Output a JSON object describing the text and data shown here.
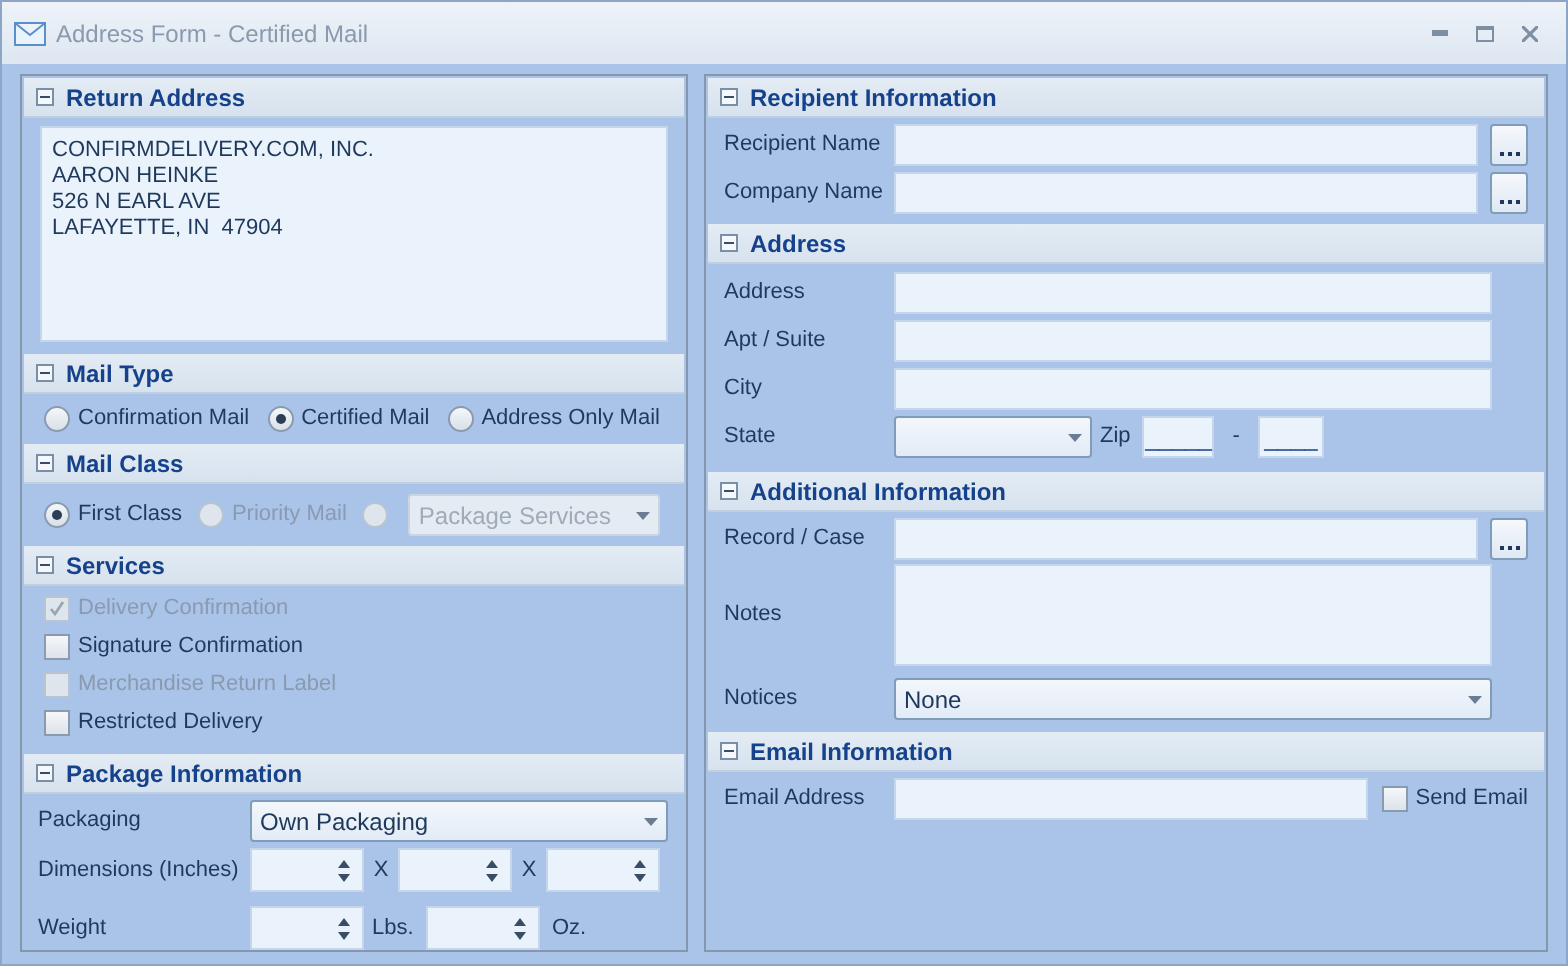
{
  "window": {
    "title": "Address Form - Certified Mail"
  },
  "return_address": {
    "title": "Return Address",
    "lines": [
      "CONFIRMDELIVERY.COM, INC.",
      "AARON HEINKE",
      "526 N EARL AVE",
      "LAFAYETTE, IN  47904"
    ]
  },
  "mail_type": {
    "title": "Mail Type",
    "options": [
      {
        "label": "Confirmation Mail",
        "selected": false
      },
      {
        "label": "Certified Mail",
        "selected": true
      },
      {
        "label": "Address Only Mail",
        "selected": false
      }
    ]
  },
  "mail_class": {
    "title": "Mail Class",
    "options": [
      {
        "kind": "radio",
        "label": "First Class",
        "selected": true,
        "disabled": false
      },
      {
        "kind": "radio",
        "label": "Priority Mail",
        "selected": false,
        "disabled": true
      },
      {
        "kind": "radio_select",
        "value": "Package Services",
        "selected": false,
        "disabled": true
      }
    ]
  },
  "services": {
    "title": "Services",
    "items": [
      {
        "label": "Delivery Confirmation",
        "checked": true,
        "disabled": true
      },
      {
        "label": "Signature Confirmation",
        "checked": false,
        "disabled": false
      },
      {
        "label": "Merchandise Return Label",
        "checked": false,
        "disabled": true
      },
      {
        "label": "Restricted Delivery",
        "checked": false,
        "disabled": false
      }
    ]
  },
  "package": {
    "title": "Package Information",
    "packaging": {
      "label": "Packaging",
      "value": "Own Packaging"
    },
    "dimensions": {
      "label": "Dimensions (Inches)",
      "separators": [
        "X",
        "X"
      ]
    },
    "weight": {
      "label": "Weight",
      "units": [
        "Lbs.",
        "Oz."
      ]
    }
  },
  "recipient": {
    "title": "Recipient Information",
    "fields": [
      {
        "kind": "text",
        "label": "Recipient Name",
        "lookup": true
      },
      {
        "kind": "text",
        "label": "Company Name",
        "lookup": true
      }
    ]
  },
  "address": {
    "title": "Address",
    "fields": [
      {
        "kind": "text",
        "label": "Address",
        "lookup": false
      },
      {
        "kind": "text",
        "label": "Apt / Suite",
        "lookup": false
      },
      {
        "kind": "text",
        "label": "City",
        "lookup": false
      },
      {
        "kind": "state_zip",
        "label": "State",
        "zip_label": "Zip",
        "separator": "-",
        "zip_masks": [
          "_____",
          "____"
        ]
      }
    ]
  },
  "additional": {
    "title": "Additional Information",
    "fields": [
      {
        "kind": "text",
        "label": "Record / Case",
        "lookup": true
      },
      {
        "kind": "memo",
        "label": "Notes"
      },
      {
        "kind": "select",
        "label": "Notices",
        "value": "None"
      }
    ]
  },
  "email": {
    "title": "Email Information",
    "label": "Email Address",
    "send_email": {
      "label": "Send Email",
      "checked": false
    }
  }
}
